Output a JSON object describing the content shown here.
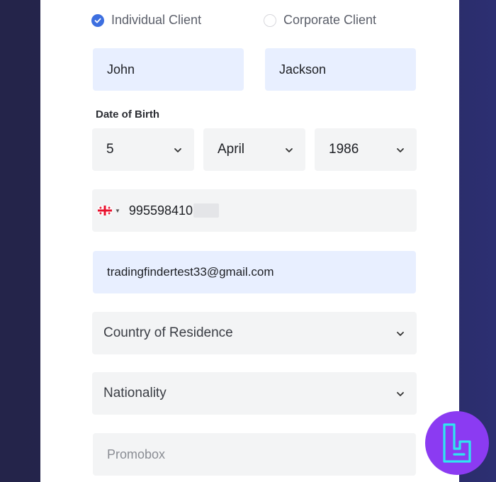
{
  "client_type": {
    "options": [
      {
        "label": "Individual Client",
        "checked": true
      },
      {
        "label": "Corporate Client",
        "checked": false
      }
    ]
  },
  "name": {
    "first_name": "John",
    "last_name": "Jackson"
  },
  "dob": {
    "label": "Date of Birth",
    "day": "5",
    "month": "April",
    "year": "1986"
  },
  "phone": {
    "country_flag": "georgia-flag-icon",
    "number": "995598410"
  },
  "email": {
    "value": "tradingfindertest33@gmail.com"
  },
  "country_of_residence": {
    "placeholder": "Country of Residence"
  },
  "nationality": {
    "placeholder": "Nationality"
  },
  "promobox": {
    "placeholder": "Promobox"
  },
  "colors": {
    "accent": "#3d6fe0",
    "autofill_bg": "#e8efff",
    "field_bg": "#f3f4f5",
    "logo_bg": "#8b3bf2",
    "logo_fg": "#2ee6f0"
  },
  "watermark": {
    "icon": "tradingfinder-logo-icon"
  }
}
